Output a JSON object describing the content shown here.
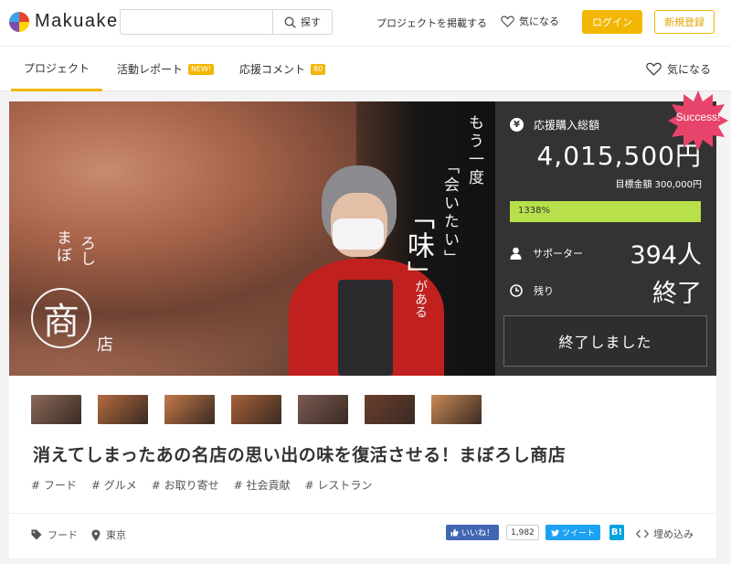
{
  "header": {
    "logo_text": "Makuake",
    "search": {
      "placeholder": "",
      "button_label": "探す"
    },
    "post_project": "プロジェクトを掲載する",
    "favorites": "気になる",
    "login": "ログイン",
    "signup": "新規登録"
  },
  "tabs": [
    {
      "label": "プロジェクト",
      "active": true,
      "badge": ""
    },
    {
      "label": "活動レポート",
      "active": false,
      "badge": "NEW!"
    },
    {
      "label": "応援コメント",
      "active": false,
      "badge": "80"
    }
  ],
  "nav_favorite": "気になる",
  "hero": {
    "slogan_line1": "もう一度",
    "slogan_line2": "「会いたい」",
    "slogan_big": "「味」",
    "slogan_tail": "がある",
    "shop_logo_line1": "まぼ",
    "shop_logo_line2": "ろし",
    "shop_logo_char": "商",
    "shop_logo_ten": "店"
  },
  "stats": {
    "total_label": "応援購入総額",
    "total_amount": "4,015,500円",
    "goal_text": "目標金額 300,000円",
    "progress_text": "1338%",
    "progress_percent": 1338,
    "supporters_label": "サポーター",
    "supporters_value": "394人",
    "remaining_label": "残り",
    "remaining_value": "終了",
    "status_button": "終了しました",
    "success_badge": "Success!"
  },
  "thumbnails": [
    {
      "color": "#8a6a5a"
    },
    {
      "color": "#b46b3f"
    },
    {
      "color": "#c4794a"
    },
    {
      "color": "#a8613a"
    },
    {
      "color": "#7a5a52"
    },
    {
      "color": "#6a3e2e"
    },
    {
      "color": "#c98a55"
    }
  ],
  "project": {
    "title": "消えてしまったあの名店の思い出の味を復活させる！まぼろし商店",
    "tags": [
      "# フード",
      "# グルメ",
      "# お取り寄せ",
      "# 社会貢献",
      "# レストラン"
    ],
    "category": "フード",
    "location": "東京"
  },
  "share": {
    "fb_label": "いいね！",
    "fb_count": "1,982",
    "tw_label": "ツイート",
    "hatena_label": "B!",
    "embed_label": "埋め込み"
  },
  "colors": {
    "accent": "#f2b705",
    "progress": "#b8e04a",
    "success": "#e8436a",
    "sidebar": "#333333"
  }
}
